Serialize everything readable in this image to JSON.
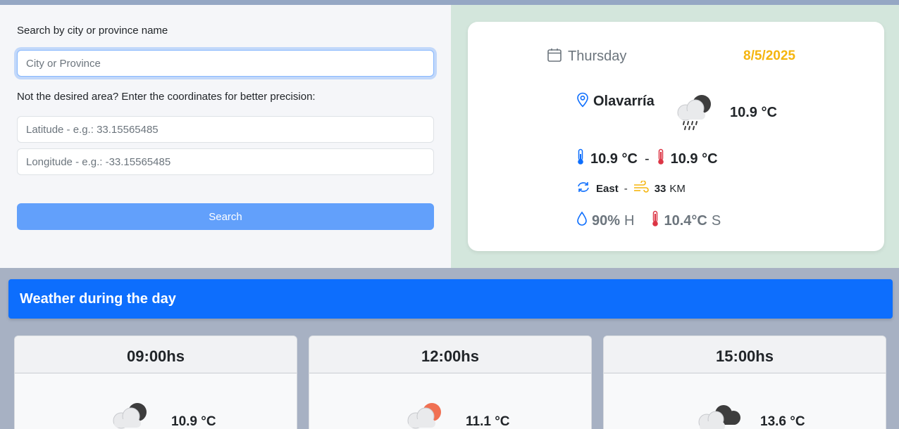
{
  "search": {
    "city_label": "Search by city or province name",
    "city_placeholder": "City or Province",
    "coords_label": "Not the desired area? Enter the coordinates for better precision:",
    "latitude_placeholder": "Latitude - e.g.: 33.15565485",
    "longitude_placeholder": "Longitude - e.g.: -33.15565485",
    "button_label": "Search"
  },
  "current": {
    "day": "Thursday",
    "date": "8/5/2025",
    "city": "Olavarría",
    "temp": "10.9 °C",
    "min_temp": "10.9 °C",
    "max_temp": "10.9 °C",
    "separator": "-",
    "wind_direction": "East",
    "wind_speed": "33",
    "wind_unit": "KM",
    "humidity": "90%",
    "humidity_suffix": "H",
    "feels_like": "10.4°C",
    "feels_like_suffix": "S"
  },
  "daily": {
    "title": "Weather during the day",
    "forecasts": [
      {
        "hour": "09:00hs",
        "temp": "10.9 °C",
        "icon": "cloud-rain-night-icon"
      },
      {
        "hour": "12:00hs",
        "temp": "11.1 °C",
        "icon": "cloud-rain-sun-icon"
      },
      {
        "hour": "15:00hs",
        "temp": "13.6 °C",
        "icon": "cloud-dark-icon"
      }
    ]
  },
  "colors": {
    "accent": "#0d6efd",
    "date": "#f5b50f",
    "search_button": "#62a0fb",
    "current_panel_bg": "#d3e6dc"
  }
}
